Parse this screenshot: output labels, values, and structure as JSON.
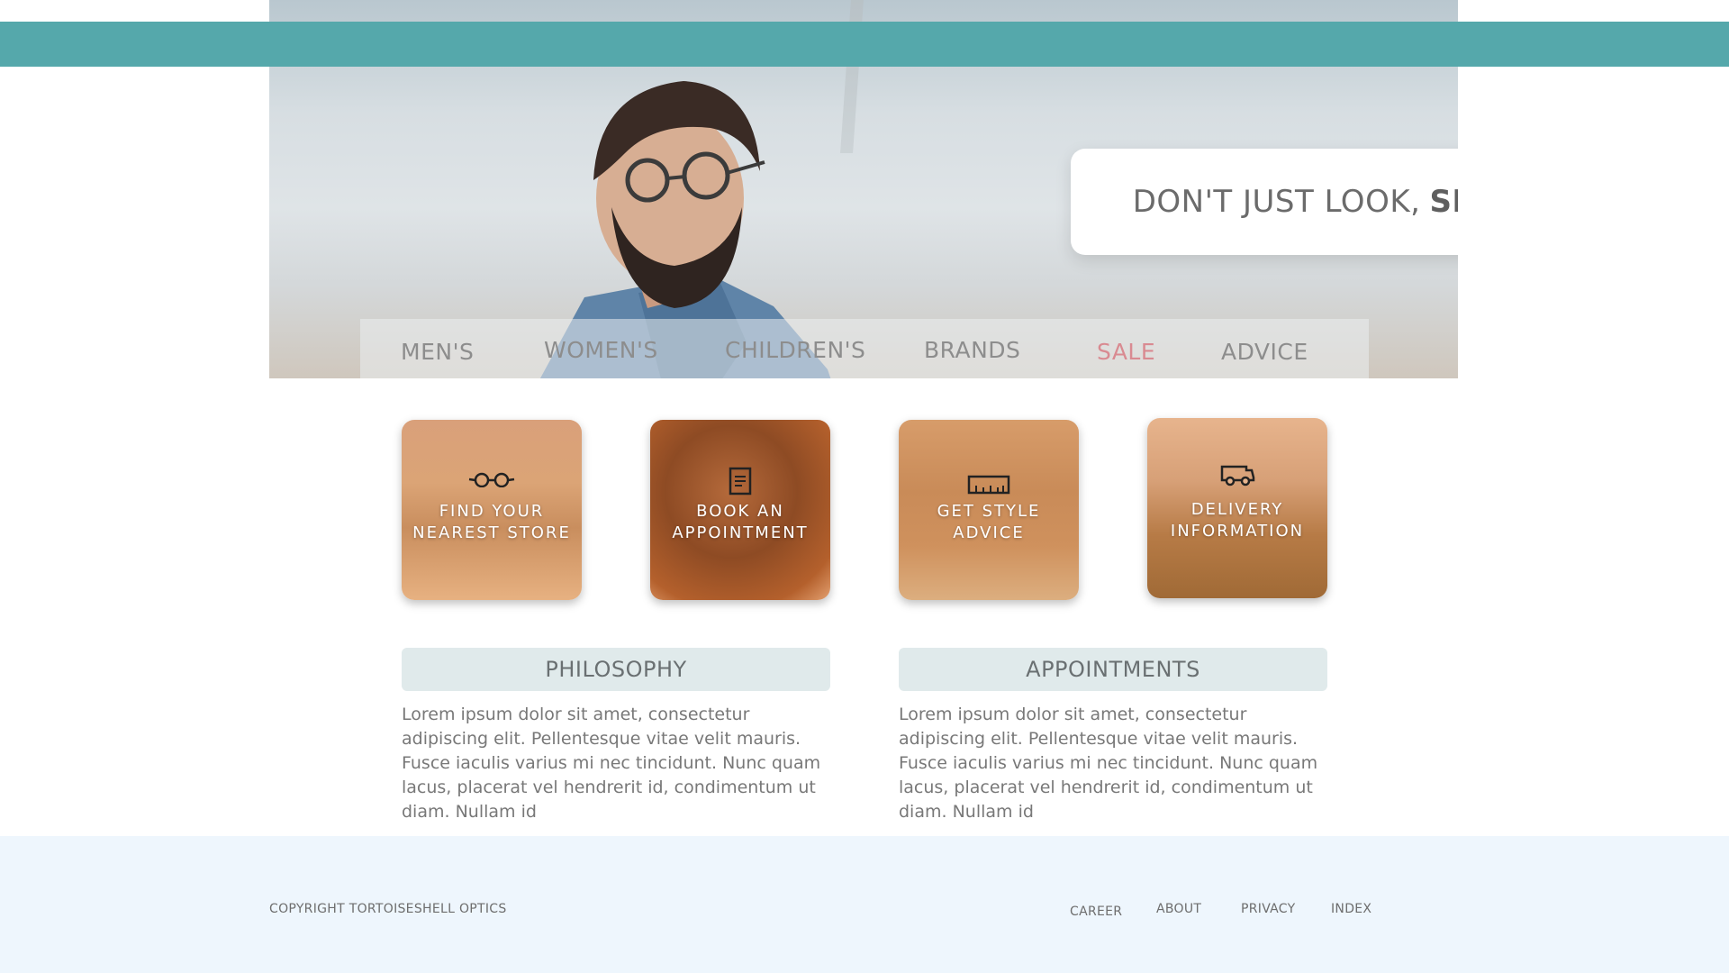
{
  "hero": {
    "tagline_light": "DON'T JUST LOOK,",
    "tagline_bold": "SEE."
  },
  "nav": {
    "items": [
      {
        "label": "MEN'S"
      },
      {
        "label": "WOMEN'S"
      },
      {
        "label": "CHILDREN'S"
      },
      {
        "label": "BRANDS"
      },
      {
        "label": "SALE"
      },
      {
        "label": "ADVICE"
      }
    ]
  },
  "tiles": [
    {
      "label": "FIND YOUR\nNEAREST STORE",
      "icon": "glasses-icon"
    },
    {
      "label": "BOOK AN\nAPPOINTMENT",
      "icon": "document-icon"
    },
    {
      "label": "GET STYLE\nADVICE",
      "icon": "ruler-icon"
    },
    {
      "label": "DELIVERY\nINFORMATION",
      "icon": "van-icon"
    }
  ],
  "sections": [
    {
      "title": "PHILOSOPHY",
      "body": "Lorem ipsum dolor sit amet, consectetur adipiscing elit. Pellentesque vitae velit mauris. Fusce iaculis varius mi nec tincidunt. Nunc quam lacus, placerat vel hendrerit id, condimentum ut diam. Nullam id"
    },
    {
      "title": "APPOINTMENTS",
      "body": "Lorem ipsum dolor sit amet, consectetur adipiscing elit. Pellentesque vitae velit mauris. Fusce iaculis varius mi nec tincidunt. Nunc quam lacus, placerat vel hendrerit id, condimentum ut diam. Nullam id"
    }
  ],
  "footer": {
    "copyright": "COPYRIGHT TORTOISESHELL OPTICS",
    "links": [
      "CAREER",
      "ABOUT",
      "PRIVACY",
      "INDEX"
    ]
  },
  "colors": {
    "topbar": "#55a8ab",
    "sale": "#d98a91",
    "footer_bg": "#eef6fd",
    "section_title_bg": "#e0eaeb"
  }
}
